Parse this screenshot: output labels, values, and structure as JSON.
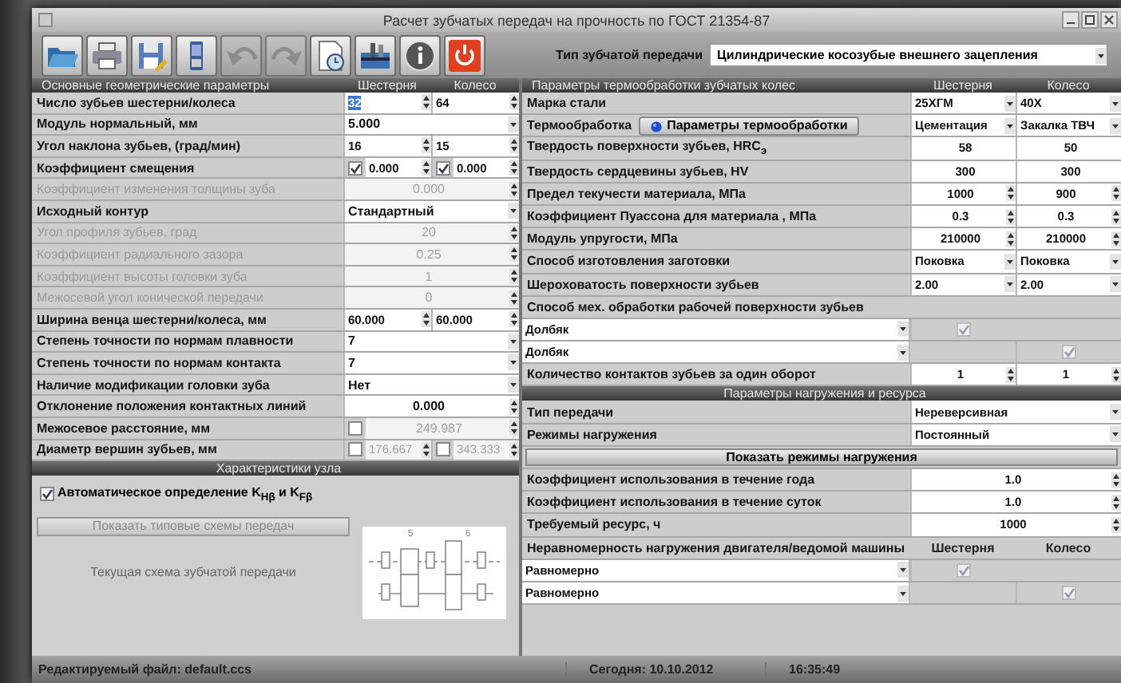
{
  "window": {
    "title": "Расчет зубчатых передач на прочность по ГОСТ 21354-87"
  },
  "toolbar": [
    {
      "kind": "open",
      "disabled": false
    },
    {
      "kind": "print",
      "disabled": false
    },
    {
      "kind": "save",
      "disabled": false
    },
    {
      "kind": "device",
      "disabled": false
    },
    {
      "kind": "undo",
      "disabled": true
    },
    {
      "kind": "redo",
      "disabled": true
    },
    {
      "kind": "report",
      "disabled": false
    },
    {
      "kind": "tools",
      "disabled": false
    },
    {
      "kind": "info",
      "disabled": false
    },
    {
      "kind": "exit",
      "disabled": false
    }
  ],
  "gear_type": {
    "label": "Тип зубчатой передачи",
    "value": "Цилиндрические косозубые внешнего зацепления"
  },
  "geometry": {
    "title": "Основные геометрические параметры",
    "columns": [
      "Шестерня",
      "Колесо"
    ],
    "rows": [
      {
        "kind": "field",
        "label": "Число зубьев шестерни/колеса",
        "disabled": false,
        "cells": [
          {
            "kind": "spin",
            "value": "32",
            "selected": true
          },
          {
            "kind": "spin",
            "value": "64",
            "selected": false
          }
        ]
      },
      {
        "kind": "field",
        "label": "Модуль нормальный, мм",
        "disabled": false,
        "cells": [
          {
            "kind": "select",
            "value": "5.000"
          }
        ]
      },
      {
        "kind": "field",
        "label": "Угол наклона зубьев,  (град/мин)",
        "disabled": false,
        "cells": [
          {
            "kind": "spin",
            "value": "16"
          },
          {
            "kind": "spin",
            "value": "15"
          }
        ]
      },
      {
        "kind": "field",
        "label": "Коэффициент смещения",
        "disabled": false,
        "cells": [
          {
            "kind": "spin",
            "value": "0.000",
            "checkbox": {
              "checked": true
            }
          },
          {
            "kind": "spin",
            "value": "0.000",
            "checkbox": {
              "checked": true
            }
          }
        ]
      },
      {
        "kind": "field",
        "label": "Коэффициент изменения толщины зуба",
        "disabled": true,
        "cells": [
          {
            "kind": "spin",
            "value": "0.000"
          }
        ]
      },
      {
        "kind": "field",
        "label": "Исходный контур",
        "disabled": false,
        "cells": [
          {
            "kind": "select",
            "value": "Стандартный"
          }
        ]
      },
      {
        "kind": "field",
        "label": "Угол профиля зубьев, град",
        "disabled": true,
        "cells": [
          {
            "kind": "spin",
            "value": "20"
          }
        ]
      },
      {
        "kind": "field",
        "label": "Коэффициент радиального зазора",
        "disabled": true,
        "cells": [
          {
            "kind": "spin",
            "value": "0.25"
          }
        ]
      },
      {
        "kind": "field",
        "label": "Коэффициент высоты  головки зуба",
        "disabled": true,
        "cells": [
          {
            "kind": "spin",
            "value": "1"
          }
        ]
      },
      {
        "kind": "field",
        "label": "Межосевой угол конической передачи",
        "disabled": true,
        "cells": [
          {
            "kind": "spin",
            "value": "0"
          }
        ]
      },
      {
        "kind": "field",
        "label": "Ширина венца шестерни/колеса, мм",
        "disabled": false,
        "cells": [
          {
            "kind": "spin",
            "value": "60.000"
          },
          {
            "kind": "spin",
            "value": "60.000"
          }
        ]
      },
      {
        "kind": "field",
        "label": "Степень точности по нормам плавности",
        "disabled": false,
        "cells": [
          {
            "kind": "select",
            "value": "7"
          }
        ]
      },
      {
        "kind": "field",
        "label": "Степень точности по нормам контакта",
        "disabled": false,
        "cells": [
          {
            "kind": "select",
            "value": "7"
          }
        ]
      },
      {
        "kind": "field",
        "label": "Наличие модификации головки зуба",
        "disabled": false,
        "cells": [
          {
            "kind": "select",
            "value": "Нет"
          }
        ]
      },
      {
        "kind": "field",
        "label": "Отклонение положения контактных линий",
        "disabled": false,
        "cells": [
          {
            "kind": "spin",
            "value": "0.000"
          }
        ]
      },
      {
        "kind": "field",
        "label": "Межосевое расстояние, мм",
        "disabled": false,
        "cells": [
          {
            "kind": "spin",
            "value": "249.987",
            "checkbox": {
              "checked": false
            }
          }
        ]
      },
      {
        "kind": "field",
        "label": "Диаметр вершин зубьев, мм",
        "disabled": false,
        "cells": [
          {
            "kind": "spin",
            "value": "176.667",
            "checkbox": {
              "checked": false
            }
          },
          {
            "kind": "spin",
            "value": "343.333",
            "checkbox": {
              "checked": false
            }
          }
        ]
      }
    ]
  },
  "node": {
    "title": "Характеристики узла",
    "auto": {
      "label": "Автоматическое определение K$_{Hβ}$ и K$_{Fβ}$",
      "checked": true
    },
    "button": {
      "label": "Показать типовые схемы передач",
      "disabled": true
    },
    "scheme_label": "Текущая схема зубчатой передачи",
    "scheme_marks": [
      "5",
      "6"
    ]
  },
  "heat": {
    "title": "Параметры термообработки зубчатых колес",
    "columns": [
      "Шестерня",
      "Колесо"
    ],
    "rows": [
      {
        "kind": "field",
        "label": "Марка стали",
        "cells": [
          {
            "kind": "select",
            "value": "25ХГМ"
          },
          {
            "kind": "select",
            "value": "40Х"
          }
        ]
      },
      {
        "kind": "field",
        "label": "Термообработка",
        "button": "Параметры термообработки",
        "cells": [
          {
            "kind": "select",
            "value": "Цементация"
          },
          {
            "kind": "select",
            "value": "Закалка ТВЧ"
          }
        ]
      },
      {
        "kind": "field",
        "label": "Твердость поверхности зубьев, HRC$_{э}$",
        "cells": [
          {
            "kind": "text",
            "value": "58"
          },
          {
            "kind": "text",
            "value": "50"
          }
        ]
      },
      {
        "kind": "field",
        "label": "Твердость сердцевины зубьев, HV",
        "cells": [
          {
            "kind": "text",
            "value": "300"
          },
          {
            "kind": "text",
            "value": "300"
          }
        ]
      },
      {
        "kind": "field",
        "label": "Предел текучести материала, МПа",
        "cells": [
          {
            "kind": "spin",
            "value": "1000"
          },
          {
            "kind": "spin",
            "value": "900"
          }
        ]
      },
      {
        "kind": "field",
        "label": "Коэффициент Пуассона для материала , МПа",
        "cells": [
          {
            "kind": "spin",
            "value": "0.3"
          },
          {
            "kind": "spin",
            "value": "0.3"
          }
        ]
      },
      {
        "kind": "field",
        "label": "Модуль упругости, МПа",
        "cells": [
          {
            "kind": "spin",
            "value": "210000"
          },
          {
            "kind": "spin",
            "value": "210000"
          }
        ]
      },
      {
        "kind": "field",
        "label": "Способ изготовления заготовки",
        "cells": [
          {
            "kind": "select",
            "value": "Поковка"
          },
          {
            "kind": "select",
            "value": "Поковка"
          }
        ]
      },
      {
        "kind": "field",
        "label": "Шероховатость поверхности зубьев",
        "cells": [
          {
            "kind": "select",
            "value": "2.00"
          },
          {
            "kind": "select",
            "value": "2.00"
          }
        ]
      },
      {
        "kind": "note",
        "label": "Способ мех. обработки рабочей поверхности зубьев"
      },
      {
        "kind": "choice",
        "value": "Долбяк",
        "cells": [
          {
            "kind": "check",
            "checked": true
          },
          {
            "kind": "blank"
          }
        ]
      },
      {
        "kind": "choice",
        "value": "Долбяк",
        "cells": [
          {
            "kind": "blank"
          },
          {
            "kind": "check",
            "checked": true
          }
        ]
      },
      {
        "kind": "field",
        "label": "Количество контактов зубьев  за один оборот",
        "cells": [
          {
            "kind": "spin",
            "value": "1"
          },
          {
            "kind": "spin",
            "value": "1"
          }
        ]
      }
    ]
  },
  "load": {
    "title": "Параметры нагружения и ресурса",
    "rows": [
      {
        "kind": "field",
        "label": "Тип передачи",
        "cells": [
          {
            "kind": "select",
            "value": "Нереверсивная"
          }
        ]
      },
      {
        "kind": "field",
        "label": "Режимы нагружения",
        "cells": [
          {
            "kind": "select",
            "value": "Постоянный"
          }
        ]
      },
      {
        "kind": "action",
        "label": "Показать режимы нагружения"
      },
      {
        "kind": "field",
        "label": "Коэффициент использования в течение года",
        "cells": [
          {
            "kind": "spin",
            "value": "1.0"
          }
        ]
      },
      {
        "kind": "field",
        "label": "Коэффициент использования в течение суток",
        "cells": [
          {
            "kind": "spin",
            "value": "1.0"
          }
        ]
      },
      {
        "kind": "field",
        "label": "Требуемый ресурс, ч",
        "cells": [
          {
            "kind": "spin",
            "value": "1000"
          }
        ]
      },
      {
        "kind": "captions",
        "label": "Неравномерность нагружения двигателя/ведомой машины",
        "cells": [
          {
            "kind": "caption",
            "value": "Шестерня"
          },
          {
            "kind": "caption",
            "value": "Колесо"
          }
        ]
      },
      {
        "kind": "choice",
        "value": "Равномерно",
        "cells": [
          {
            "kind": "check",
            "checked": true
          },
          {
            "kind": "blank"
          }
        ]
      },
      {
        "kind": "choice",
        "value": "Равномерно",
        "cells": [
          {
            "kind": "blank"
          },
          {
            "kind": "check",
            "checked": true
          }
        ]
      }
    ]
  },
  "status_bar": {
    "file": "Редактируемый файл: default.ccs",
    "date": "Сегодня:  10.10.2012",
    "time": "16:35:49"
  }
}
